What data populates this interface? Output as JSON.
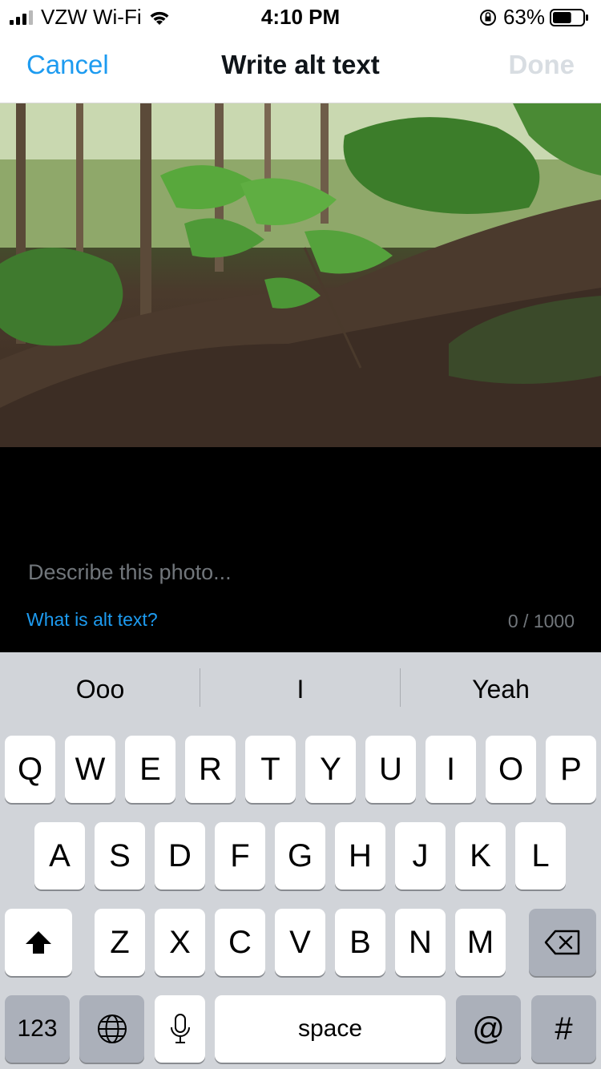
{
  "status_bar": {
    "carrier": "VZW Wi-Fi",
    "time": "4:10 PM",
    "battery_percent": "63%",
    "icons": [
      "signal-icon",
      "wifi-icon",
      "orientation-lock-icon",
      "battery-icon"
    ],
    "battery_level": 0.63
  },
  "nav": {
    "cancel_label": "Cancel",
    "title": "Write alt text",
    "done_label": "Done"
  },
  "description": {
    "placeholder": "Describe this photo...",
    "value": "",
    "help_link": "What is alt text?",
    "char_count": "0 / 1000"
  },
  "keyboard": {
    "suggestions": [
      "Ooo",
      "I",
      "Yeah"
    ],
    "row1": [
      "Q",
      "W",
      "E",
      "R",
      "T",
      "Y",
      "U",
      "I",
      "O",
      "P"
    ],
    "row2": [
      "A",
      "S",
      "D",
      "F",
      "G",
      "H",
      "J",
      "K",
      "L"
    ],
    "row3": [
      "Z",
      "X",
      "C",
      "V",
      "B",
      "N",
      "M"
    ],
    "numbers_label": "123",
    "space_label": "space",
    "at_label": "@",
    "hash_label": "#",
    "icons": [
      "shift-icon",
      "backspace-icon",
      "globe-icon",
      "microphone-icon"
    ]
  },
  "colors": {
    "accent": "#1d9bf0",
    "done_disabled": "#d8dde2",
    "placeholder": "#71767b",
    "keyboard_bg": "#d1d4d9"
  }
}
